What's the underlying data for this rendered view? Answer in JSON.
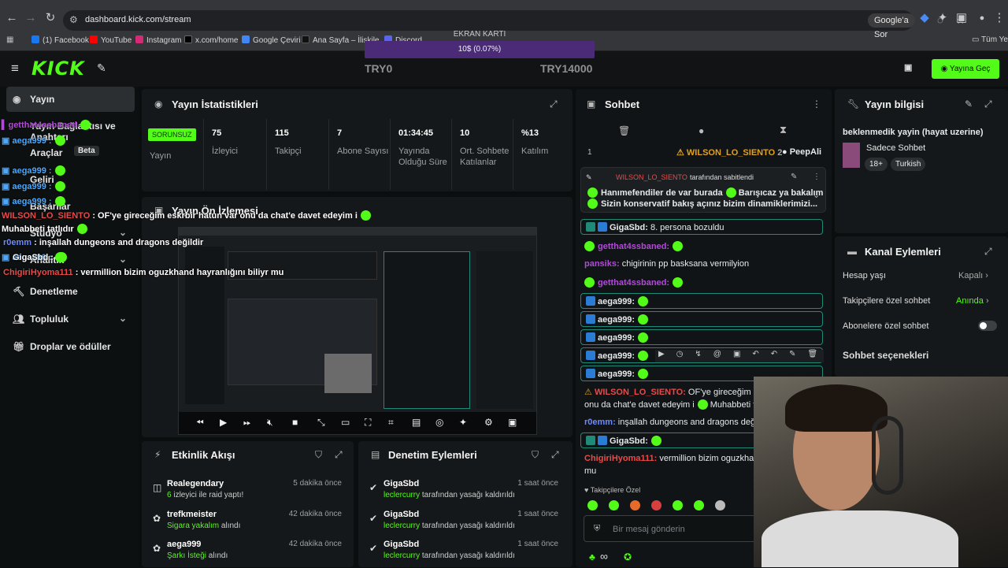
{
  "browser": {
    "url": "dashboard.kick.com/stream",
    "ask_google": "Google'a Sor",
    "bookmarks": [
      {
        "label": "(1) Facebook",
        "color": "#1877f2"
      },
      {
        "label": "YouTube",
        "color": "#ff0000"
      },
      {
        "label": "Instagram",
        "color": "#d62976"
      },
      {
        "label": "x.com/home",
        "color": "#000000"
      },
      {
        "label": "Google Çeviri",
        "color": "#4285f4"
      },
      {
        "label": "Ana Sayfa – İlişkile",
        "color": "#111111"
      },
      {
        "label": "Discord",
        "color": "#5865f2"
      }
    ],
    "all_bookmarks": "Tüm Yer"
  },
  "gpu": {
    "title": "EKRAN KARTI",
    "value": "10$ (0.07%)"
  },
  "header": {
    "logo": "KICK",
    "try_left": "TRY0",
    "try_right": "TRY14000",
    "go_live": "Yayına Geç"
  },
  "sidebar": {
    "items": [
      {
        "label": "Yayın",
        "icon": "broadcast-icon"
      },
      {
        "label": "Yayın Bağlantısı ve Anahtarı"
      },
      {
        "label": "Araçlar"
      },
      {
        "label": "Beta"
      },
      {
        "label": "Geliri"
      },
      {
        "label": "Başarılar"
      },
      {
        "label": "Stüdyo"
      },
      {
        "label": "Analitik"
      },
      {
        "label": "Denetleme"
      },
      {
        "label": "Topluluk"
      },
      {
        "label": "Droplar ve ödüller"
      }
    ]
  },
  "stats": {
    "title": "Yayın İstatistikleri",
    "badge": "SORUNSUZ",
    "status_label": "Yayın",
    "items": [
      {
        "value": "75",
        "label": "İzleyici"
      },
      {
        "value": "115",
        "label": "Takipçi"
      },
      {
        "value": "7",
        "label": "Abone Sayısı"
      },
      {
        "value": "01:34:45",
        "label": "Yayında Olduğu Süre"
      },
      {
        "value": "10",
        "label": "Ort. Sohbete Katılanlar"
      },
      {
        "value": "%13",
        "label": "Katılım"
      }
    ]
  },
  "preview": {
    "title": "Yayın Ön İzlemesi"
  },
  "activity": {
    "title": "Etkinlik Akışı",
    "items": [
      {
        "name": "Realegendary",
        "detail_em": "6",
        "detail": " izleyici ile raid yaptı!",
        "time": "5 dakika önce"
      },
      {
        "name": "trefkmeister",
        "detail_em": "Sigara yakalım",
        "detail": " alındı",
        "time": "42 dakika önce"
      },
      {
        "name": "aega999",
        "detail_em": "Şarkı İsteği",
        "detail": " alındı",
        "time": "42 dakika önce"
      }
    ]
  },
  "moderation": {
    "title": "Denetim Eylemleri",
    "items": [
      {
        "name": "GigaSbd",
        "who": "leclercurry",
        "detail": " tarafından yasağı kaldırıldı",
        "time": "1 saat önce"
      },
      {
        "name": "GigaSbd",
        "who": "leclercurry",
        "detail": " tarafından yasağı kaldırıldı",
        "time": "1 saat önce"
      },
      {
        "name": "GigaSbd",
        "who": "leclercurry",
        "detail": " tarafından yasağı kaldırıldı",
        "time": "1 saat önce"
      }
    ]
  },
  "chat": {
    "title": "Sohbet",
    "top_count": "1",
    "top_user": "WILSON_LO_SIENTO",
    "top_n": "2",
    "top_user2": "PeepAli",
    "pinned_by": "WILSON_LO_SIENTO",
    "pinned_suffix": "tarafından sabitlendi",
    "pinned_line1": "Hanımefendiler de var burada",
    "pinned_line1b": "Barışıcaz ya bakalım",
    "pinned_line2": "Sizin konservatif bakış açınız bizim dinamiklerimizi...",
    "messages": [
      {
        "user": "GigaSbd:",
        "text": " 8. persona bozuldu",
        "color": "#ffffff"
      },
      {
        "user": "getthat4ssbaned:",
        "text": "",
        "color": "#b04bd6"
      },
      {
        "user": "pansiks:",
        "text": " chigirinin pp basksana vermilyion",
        "color": "#b04bd6"
      },
      {
        "user": "getthat4ssbaned:",
        "text": "",
        "color": "#b04bd6"
      },
      {
        "user": "aega999:",
        "text": "",
        "color": "#ffffff"
      },
      {
        "user": "aega999:",
        "text": "",
        "color": "#ffffff"
      },
      {
        "user": "aega999:",
        "text": "",
        "color": "#ffffff"
      },
      {
        "user": "aega999:",
        "text": "",
        "color": "#ffffff"
      },
      {
        "user": "aega999:",
        "text": "",
        "color": "#ffffff"
      }
    ],
    "wilson_line": "WILSON_LO_SIENTO:",
    "wilson_text": " OF'ye gireceğim ",
    "wilson_text2": "onu da chat'e davet edeyim i",
    "wilson_text3": "Muhabbeti ta",
    "r0emm": "r0emm:",
    "r0emm_text": " inşallah dungeons and dragons değild",
    "giga": "GigaSbd:",
    "chigiri": "ChigiriHyoma111:",
    "chigiri_text": " vermillion bizim oguzkhand h",
    "chigiri_text2": "mu",
    "followers_only": "Takipçilere Özel",
    "input_placeholder": "Bir mesaj gönderin"
  },
  "info": {
    "title": "Yayın bilgisi",
    "stream_title": "beklenmedik yayin (hayat uzerine)",
    "category": "Sadece Sohbet",
    "tags": [
      "18+",
      "Turkish"
    ]
  },
  "channel": {
    "title": "Kanal Eylemleri",
    "rows": [
      {
        "label": "Hesap yaşı",
        "value": "Kapalı"
      },
      {
        "label": "Takipçilere özel sohbet",
        "value": "Anında"
      },
      {
        "label": "Abonelere özel sohbet",
        "value": ""
      }
    ],
    "chat_options": "Sohbet seçenekleri"
  },
  "overlay": [
    {
      "user": "getthat4ssbaned",
      "text": "",
      "color": "#b04bd6"
    },
    {
      "user": "aega999 :",
      "text": "",
      "color": "#4aa8ff"
    },
    {
      "user": "aega999 :",
      "text": "",
      "color": "#4aa8ff"
    },
    {
      "user": "aega999 :",
      "text": "",
      "color": "#4aa8ff"
    },
    {
      "user": "aega999 :",
      "text": "",
      "color": "#4aa8ff"
    },
    {
      "user": "aega999 :",
      "text": "",
      "color": "#4aa8ff"
    }
  ],
  "overlay2": {
    "wilson": "WILSON_LO_SIENTO",
    "wilson_text": " : OF'ye gireceğim eskrbir hatun var onu da chat'e davet edeyim i",
    "wilson_text2": "Muhabbeti tatlıdır",
    "r0emm": "r0emm",
    "r0emm_text": " : inşallah dungeons and dragons değildir",
    "giga": "GigaSbd :",
    "chigiri": "ChigiriHyoma111",
    "chigiri_text": " : vermillion bizim oguzkhand hayranlığını biliyr mu"
  }
}
